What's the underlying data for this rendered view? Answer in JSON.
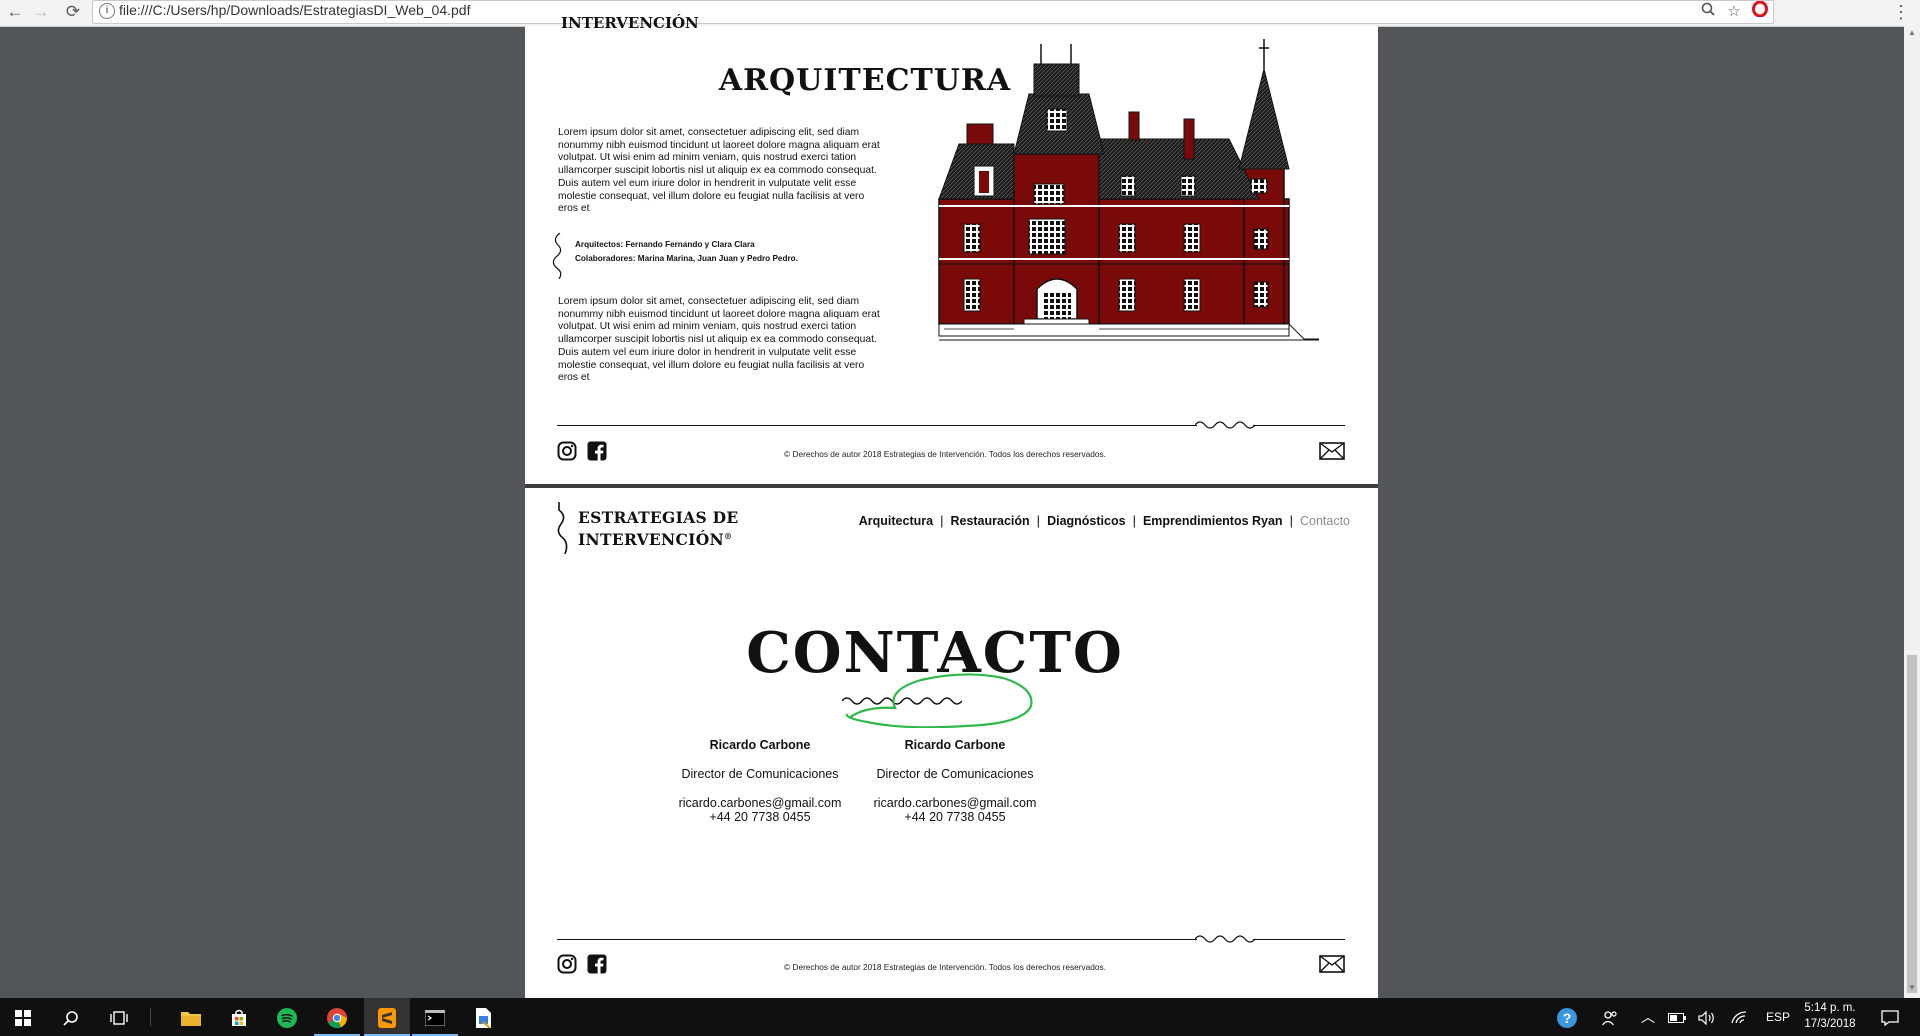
{
  "browser": {
    "url": "file:///C:/Users/hp/Downloads/EstrategiasDI_Web_04.pdf",
    "back_icon": "←",
    "forward_icon": "→",
    "reload_icon": "⟳",
    "info_icon": "i",
    "zoom_icon": "🔍",
    "star_icon": "☆",
    "menu_icon": "⋮"
  },
  "page1": {
    "header_fragment": "INTERVENCIÓN",
    "title": "ARQUITECTURA",
    "paragraph1": "Lorem ipsum dolor sit amet, consectetuer adipiscing elit, sed diam nonummy nibh euismod tincidunt ut laoreet dolore magna aliquam erat volutpat. Ut wisi enim ad minim veniam, quis nostrud exerci tation ullamcorper suscipit lobortis nisl ut aliquip ex ea commodo consequat. Duis autem vel eum iriure dolor in hendrerit in vulputate velit esse molestie consequat, vel illum dolore eu feugiat nulla facilisis at vero eros et",
    "architects": "Arquitectos: Fernando Fernando y Clara Clara",
    "collaborators": "Colaboradores: Marina Marina, Juan Juan y Pedro Pedro.",
    "paragraph2": "Lorem ipsum dolor sit amet, consectetuer adipiscing elit, sed diam nonummy nibh euismod tincidunt ut laoreet dolore magna aliquam erat volutpat. Ut wisi enim ad minim veniam, quis nostrud exerci tation ullamcorper suscipit lobortis nisl ut aliquip ex ea commodo consequat. Duis autem vel eum iriure dolor in hendrerit in vulputate velit esse molestie consequat, vel illum dolore eu feugiat nulla facilisis at vero eros et",
    "footer_copyright": "© Derechos de autor 2018 Estrategias de Intervención. Todos los derechos reservados."
  },
  "page2": {
    "logo_line1": "ESTRATEGIAS DE",
    "logo_line2": "INTERVENCIÓN",
    "logo_reg": "®",
    "nav": [
      {
        "label": "Arquitectura"
      },
      {
        "label": "Restauración"
      },
      {
        "label": "Diagnósticos"
      },
      {
        "label": "Emprendimientos Ryan"
      },
      {
        "label": "Contacto"
      }
    ],
    "nav_separator": "|",
    "nav_active_color": "#8a8a8a",
    "title": "CONTACTO",
    "contacts": [
      {
        "name": "Ricardo Carbone",
        "role": "Director de Comunicaciones",
        "email": "ricardo.carbones@gmail.com",
        "phone": "+44 20 7738 0455"
      },
      {
        "name": "Ricardo Carbone",
        "role": "Director de Comunicaciones",
        "email": "ricardo.carbones@gmail.com",
        "phone": "+44 20 7738 0455"
      }
    ],
    "footer_copyright": "© Derechos de autor 2018 Estrategias de Intervención. Todos los derechos reservados."
  },
  "colors": {
    "building_red": "#7a0a0a",
    "annotation_green": "#2db84a",
    "viewer_background": "#525659"
  },
  "taskbar": {
    "language": "ESP",
    "time": "5:14 p. m.",
    "date": "17/3/2018",
    "apps": [
      "windows-start",
      "search",
      "task-view",
      "file-explorer",
      "store",
      "spotify",
      "chrome",
      "sublime-text",
      "terminal",
      "file-editor"
    ]
  }
}
